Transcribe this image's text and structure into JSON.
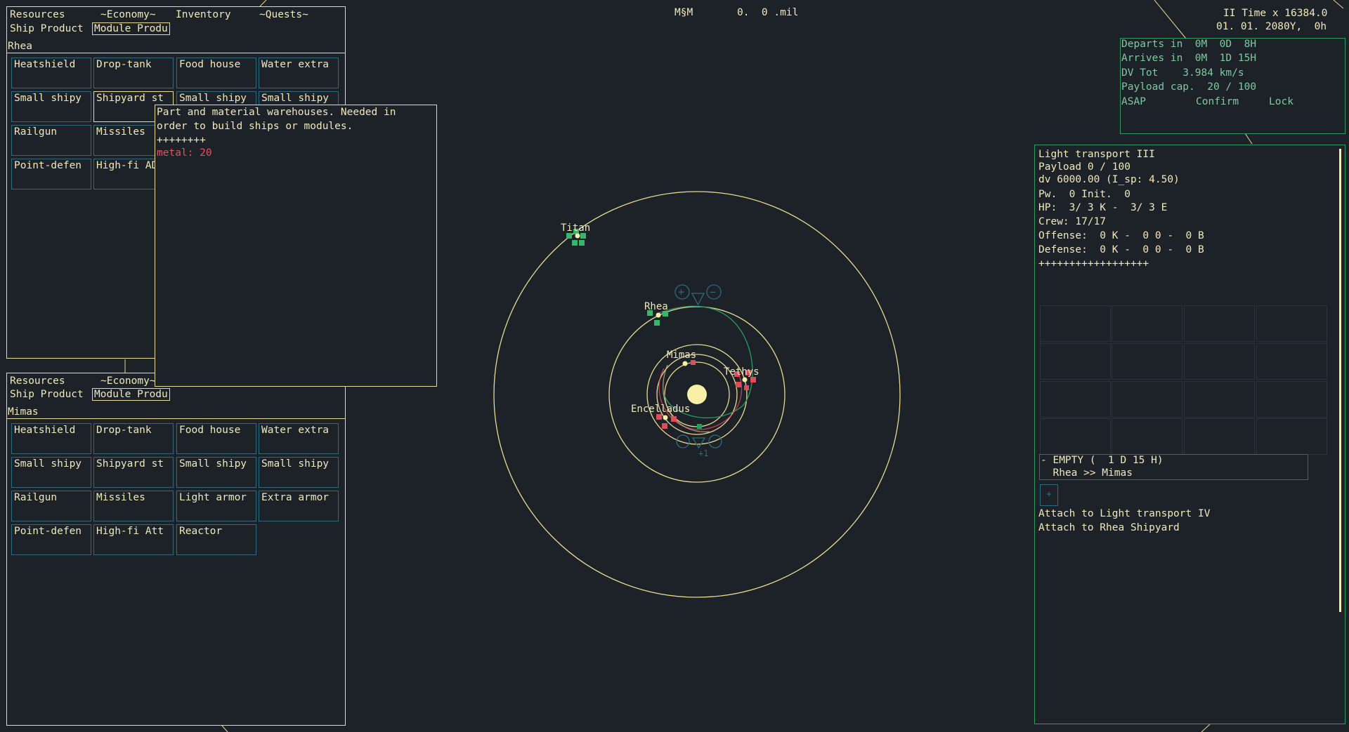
{
  "header": {
    "currency": "M§M",
    "balance": "0.  0 .mil"
  },
  "clock": {
    "time_scale": "II Time x 16384.0",
    "date": "01. 01. 2080Y,  0h"
  },
  "tabs": [
    "Resources",
    "~Economy~",
    "Inventory",
    "~Quests~"
  ],
  "subtabs": [
    "Ship Product",
    "Module Produ"
  ],
  "colony_top": {
    "name": "Rhea",
    "modules": [
      "Heatshield",
      "Drop-tank",
      "Food house",
      "Water extra",
      "Small shipy",
      "Shipyard st",
      "Small shipy",
      "Small shipy",
      "Railgun",
      "Missiles",
      "",
      "",
      "Point-defen",
      "High-fi ADD"
    ]
  },
  "colony_bottom": {
    "tabs": [
      "Resources",
      "~Economy~"
    ],
    "name": "Mimas",
    "modules": [
      "Heatshield",
      "Drop-tank",
      "Food house",
      "Water extra",
      "Small shipy",
      "Shipyard st",
      "Small shipy",
      "Small shipy",
      "Railgun",
      "Missiles",
      "Light armor",
      "Extra armor",
      "Point-defen",
      "High-fi Att",
      "Reactor"
    ]
  },
  "tooltip": {
    "line1": "Part and material warehouses. Needed in",
    "line2": "order to build ships or modules.",
    "divider": "++++++++",
    "cost": "metal: 20",
    "cost_color": "#e8505f"
  },
  "transfer": {
    "departs": "Departs in  0M  0D  8H",
    "arrives": "Arrives in  0M  1D 15H",
    "dv": "DV Tot    3.984 km/s",
    "payload": "Payload cap.  20 / 100",
    "asap": "ASAP",
    "confirm": "Confirm",
    "lock": "Lock"
  },
  "ship": {
    "name": "Light transport III",
    "payload": "Payload 0 / 100",
    "dv": "dv 6000.00 (I_sp: 4.50)",
    "power": "Pw.  0 Init.  0",
    "hp": "HP:  3/ 3 K -  3/ 3 E",
    "crew": "Crew: 17/17",
    "offense": "Offense:  0 K -  0 0 -  0 B",
    "defense": "Defense:  0 K -  0 0 -  0 B",
    "divider": "++++++++++++++++++",
    "route_status": "- EMPTY (  1 D 15 H)",
    "route_path": "  Rhea >> Mimas",
    "add_label": "+",
    "attach_ship": "Attach to Light transport IV",
    "attach_yard": "Attach to Rhea Shipyard"
  },
  "map": {
    "bodies": [
      "Titan",
      "Rhea",
      "Mimas",
      "Tethys",
      "Encelladus"
    ],
    "zoom_in": "+",
    "zoom_out": "−",
    "step_label": "+1"
  },
  "colors": {
    "accent": "#e7dc91",
    "friendly": "#36b86c",
    "hostile": "#e24b5a",
    "ui_blue": "#2e6b7f",
    "transfer_green": "#2d9a63"
  }
}
